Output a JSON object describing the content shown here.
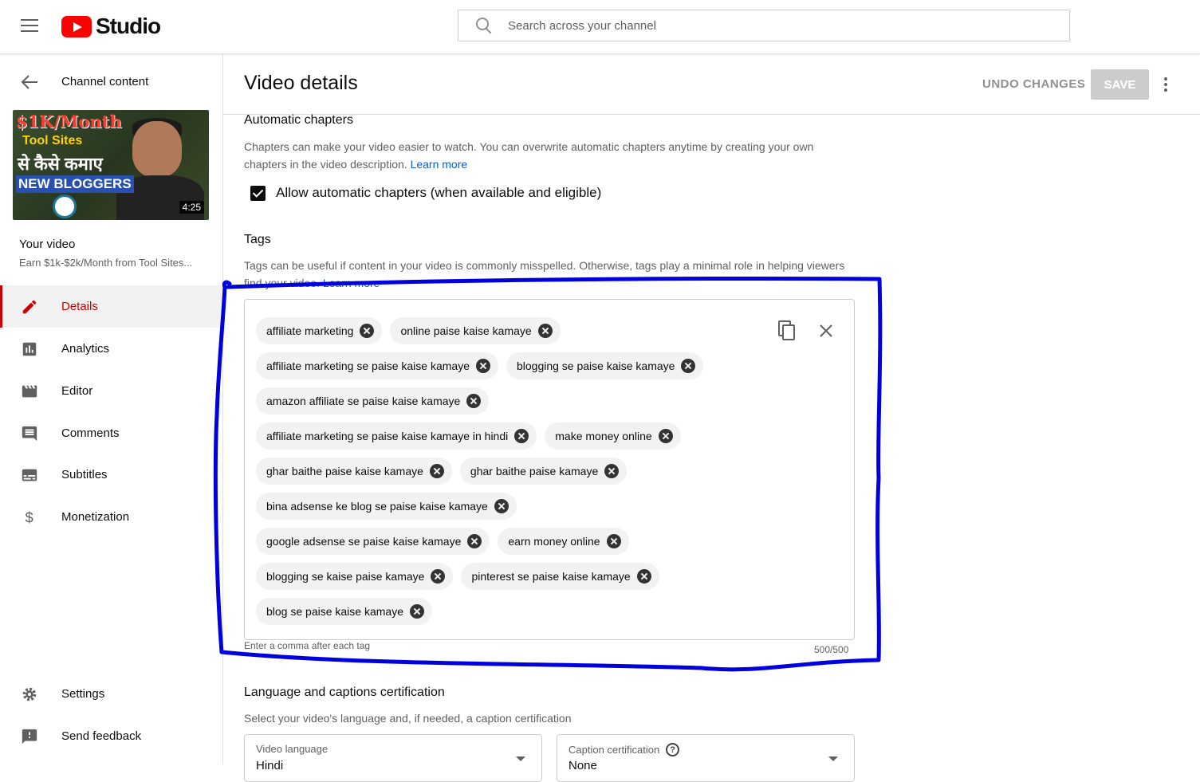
{
  "topbar": {
    "brand": "Studio",
    "search_placeholder": "Search across your channel"
  },
  "sidebar": {
    "back_label": "Channel content",
    "thumbnail": {
      "line1": "$1K/Month",
      "line2": "Tool Sites",
      "line3": "से कैसे कमाए",
      "line4": "NEW BLOGGERS",
      "duration": "4:25"
    },
    "your_video_label": "Your video",
    "video_title": "Earn $1k-$2k/Month from Tool Sites...",
    "items": [
      {
        "label": "Details",
        "icon": "pencil-icon",
        "active": true
      },
      {
        "label": "Analytics",
        "icon": "analytics-icon"
      },
      {
        "label": "Editor",
        "icon": "clapperboard-icon"
      },
      {
        "label": "Comments",
        "icon": "comment-icon"
      },
      {
        "label": "Subtitles",
        "icon": "subtitles-icon"
      },
      {
        "label": "Monetization",
        "icon": "dollar-icon"
      }
    ],
    "bottom_items": [
      {
        "label": "Settings",
        "icon": "gear-icon"
      },
      {
        "label": "Send feedback",
        "icon": "feedback-icon"
      }
    ]
  },
  "header": {
    "title": "Video details",
    "undo_label": "UNDO CHANGES",
    "save_label": "SAVE"
  },
  "chapters": {
    "title": "Automatic chapters",
    "desc": "Chapters can make your video easier to watch. You can overwrite automatic chapters anytime by creating your own chapters in the video description.",
    "learn_more": "Learn more",
    "checkbox_label": "Allow automatic chapters (when available and eligible)",
    "checked": true
  },
  "tags": {
    "title": "Tags",
    "desc": "Tags can be useful if content in your video is commonly misspelled. Otherwise, tags play a minimal role in helping viewers find your video.",
    "learn_more": "Learn more",
    "items": [
      "affiliate marketing",
      "online paise kaise kamaye",
      "affiliate marketing se paise kaise kamaye",
      "blogging se paise kaise kamaye",
      "amazon affiliate se paise kaise kamaye",
      "affiliate marketing se paise kaise kamaye in hindi",
      "make money online",
      "ghar baithe paise kaise kamaye",
      "ghar baithe paise kamaye",
      "bina adsense ke blog se paise kaise kamaye",
      "google adsense se paise kaise kamaye",
      "earn money online",
      "blogging se kaise paise kamaye",
      "pinterest se paise kaise kamaye",
      "blog se paise kaise kamaye"
    ],
    "helper": "Enter a comma after each tag",
    "counter": "500/500"
  },
  "language": {
    "title": "Language and captions certification",
    "desc": "Select your video's language and, if needed, a caption certification",
    "video_language_label": "Video language",
    "video_language_value": "Hindi",
    "caption_label": "Caption certification",
    "caption_value": "None"
  },
  "colors": {
    "accent_red": "#cc0000",
    "link_blue": "#065fd4",
    "annotation_blue": "#0000dd"
  }
}
